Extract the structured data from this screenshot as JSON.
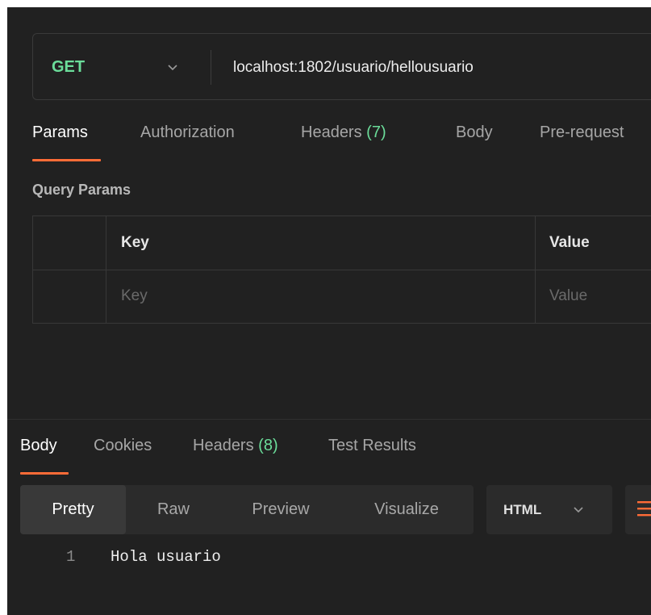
{
  "request": {
    "method": "GET",
    "method_chevron_icon": "chevron-down-icon",
    "url": "localhost:1802/usuario/hellousuario"
  },
  "request_tabs": {
    "params": "Params",
    "authorization": "Authorization",
    "headers_label": "Headers",
    "headers_count": "(7)",
    "body": "Body",
    "pre_request": "Pre-request"
  },
  "query_params": {
    "title": "Query Params",
    "header": {
      "key": "Key",
      "value": "Value"
    },
    "placeholder": {
      "key": "Key",
      "value": "Value"
    }
  },
  "response_tabs": {
    "body": "Body",
    "cookies": "Cookies",
    "headers_label": "Headers",
    "headers_count": "(8)",
    "test_results": "Test Results"
  },
  "format": {
    "options": [
      "Pretty",
      "Raw",
      "Preview",
      "Visualize"
    ],
    "selected": "Pretty",
    "language": "HTML",
    "language_chevron_icon": "chevron-down-icon",
    "wrap_icon": "wrap-lines-icon"
  },
  "response_body": {
    "lines": [
      {
        "number": "1",
        "text": "Hola usuario"
      }
    ]
  },
  "colors": {
    "accent": "#ff6c37",
    "method_get": "#6bdd9a",
    "background": "#212121"
  }
}
